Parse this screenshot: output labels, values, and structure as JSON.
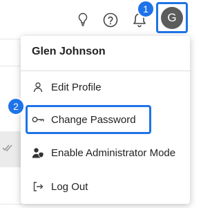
{
  "topbar": {
    "icons": [
      "lightbulb-icon",
      "help-icon",
      "bell-icon"
    ],
    "avatar_initial": "G"
  },
  "badges": {
    "step1": "1",
    "step2": "2"
  },
  "user_menu": {
    "name": "Glen Johnson",
    "items": [
      {
        "label": "Edit Profile",
        "icon": "user-icon"
      },
      {
        "label": "Change Password",
        "icon": "key-icon"
      },
      {
        "label": "Enable Administrator Mode",
        "icon": "admin-shield-user-icon"
      },
      {
        "label": "Log Out",
        "icon": "logout-icon"
      }
    ]
  },
  "colors": {
    "highlight": "#1e73e8",
    "avatar_bg": "#5c5c5c"
  }
}
